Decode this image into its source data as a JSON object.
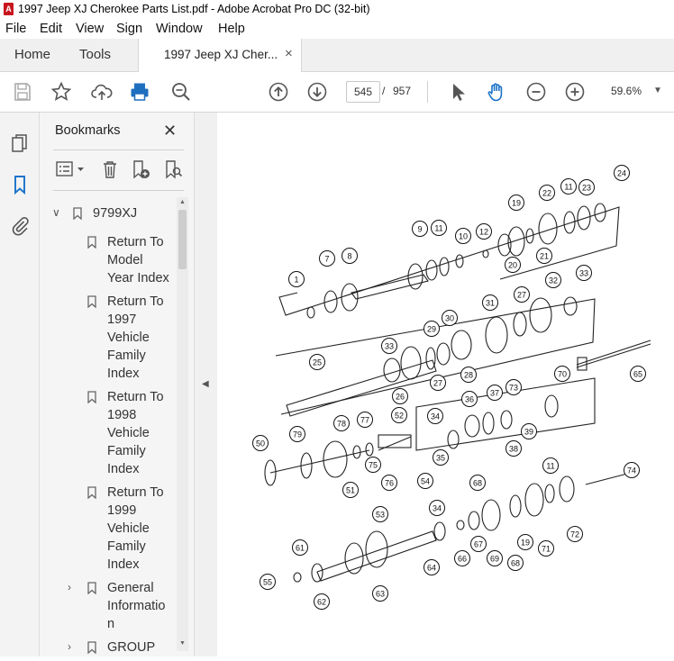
{
  "window": {
    "title": "1997 Jeep XJ Cherokee Parts List.pdf - Adobe Acrobat Pro DC (32-bit)",
    "app_icon": "acrobat-icon"
  },
  "menu": [
    "File",
    "Edit",
    "View",
    "Sign",
    "Window",
    "Help"
  ],
  "tabs": {
    "home": "Home",
    "tools": "Tools",
    "document": "1997 Jeep XJ Cher...",
    "close": "×"
  },
  "toolbar": {
    "page_current": "545",
    "page_separator": "/",
    "page_total": "957",
    "zoom": "59.6%",
    "icons": [
      "save-icon",
      "star-icon",
      "upload-icon",
      "print-icon",
      "find-zoom-icon",
      "page-up-icon",
      "page-down-icon",
      "select-arrow-icon",
      "hand-icon",
      "zoom-out-icon",
      "zoom-in-icon"
    ]
  },
  "sidebar": {
    "title": "Bookmarks",
    "close": "✕",
    "root": "9799XJ",
    "items": [
      {
        "lines": [
          "Return To",
          "Model",
          "Year Index"
        ],
        "expandable": false
      },
      {
        "lines": [
          "Return To",
          "1997",
          "Vehicle",
          "Family",
          "Index"
        ],
        "expandable": false
      },
      {
        "lines": [
          "Return To",
          "1998",
          "Vehicle",
          "Family",
          "Index"
        ],
        "expandable": false
      },
      {
        "lines": [
          "Return To",
          "1999",
          "Vehicle",
          "Family",
          "Index"
        ],
        "expandable": false
      },
      {
        "lines": [
          "General",
          "Informatio",
          "n"
        ],
        "expandable": true
      },
      {
        "lines": [
          "GROUP"
        ],
        "expandable": true
      }
    ]
  },
  "diagram": {
    "callouts": [
      "1",
      "7",
      "8",
      "9",
      "11",
      "10",
      "12",
      "19",
      "22",
      "11",
      "23",
      "24",
      "20",
      "21",
      "30",
      "29",
      "31",
      "27",
      "32",
      "33",
      "28",
      "25",
      "33",
      "26",
      "27",
      "70",
      "65",
      "73",
      "36",
      "37",
      "34",
      "39",
      "38",
      "35",
      "52",
      "78",
      "77",
      "79",
      "50",
      "75",
      "76",
      "51",
      "68",
      "11",
      "74",
      "54",
      "53",
      "34",
      "69",
      "67",
      "66",
      "64",
      "19",
      "71",
      "72",
      "68",
      "61",
      "55",
      "63",
      "62"
    ]
  },
  "colors": {
    "accent": "#1a73c8",
    "print_blue": "#1f6fbf",
    "pdf_red": "#c8161e"
  }
}
